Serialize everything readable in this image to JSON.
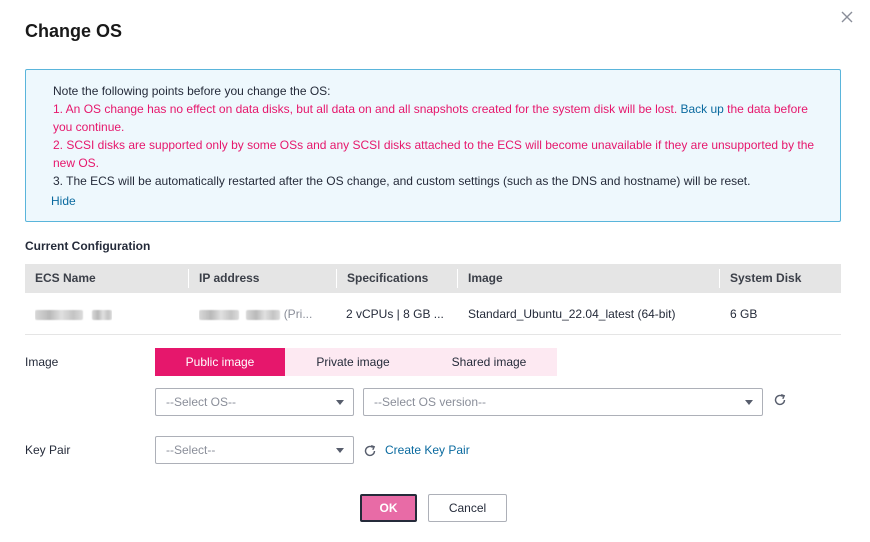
{
  "dialog": {
    "title": "Change OS",
    "close_icon": "close-icon"
  },
  "notice": {
    "intro": "Note the following points before you change the OS:",
    "point1_a": "1. An OS change has no effect on data disks, but all data on and all snapshots created for the system disk will be lost. ",
    "point1_link": "Back up",
    "point1_b": " the data before",
    "point1_c": "you continue.",
    "point2_a": "2. SCSI disks are supported only by some OSs and any SCSI disks attached to the ECS will become unavailable if they are unsupported by the",
    "point2_b": "new OS.",
    "point3": "3. The ECS will be automatically restarted after the OS change, and custom settings (such as the DNS and hostname) will be reset.",
    "hide_label": "Hide",
    "colors": {
      "border": "#5ab5db",
      "background": "#eef8fd",
      "warning": "#e6176c",
      "link": "#0a6a9f"
    }
  },
  "current_config": {
    "title": "Current Configuration",
    "columns": [
      "ECS Name",
      "IP address",
      "Specifications",
      "Image",
      "System Disk"
    ],
    "row": {
      "ip_suffix": "(Pri...",
      "specifications": "2 vCPUs | 8 GB ...",
      "image": "Standard_Ubuntu_22.04_latest (64-bit)",
      "system_disk": "6 GB"
    }
  },
  "image_field": {
    "label": "Image",
    "tabs": [
      {
        "label": "Public image",
        "active": true
      },
      {
        "label": "Private image",
        "active": false
      },
      {
        "label": "Shared image",
        "active": false
      }
    ],
    "os_select_placeholder": "--Select OS--",
    "os_version_placeholder": "--Select OS version--",
    "refresh_icon": "refresh-icon"
  },
  "key_pair_field": {
    "label": "Key Pair",
    "select_placeholder": "--Select--",
    "refresh_icon": "refresh-icon",
    "create_link": "Create Key Pair"
  },
  "footer": {
    "ok_label": "OK",
    "cancel_label": "Cancel"
  },
  "colors": {
    "accent": "#e6176c",
    "ok_button": "#e86ba6",
    "tab_inactive": "#fde9f2"
  }
}
